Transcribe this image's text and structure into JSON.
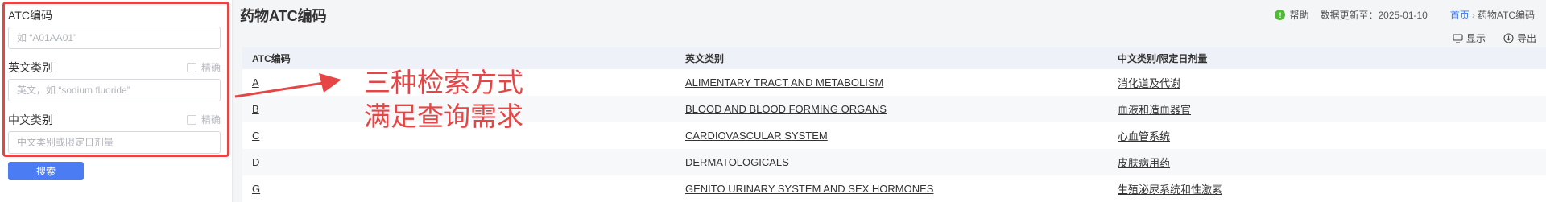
{
  "search_panel": {
    "atc_code": {
      "label": "ATC编码",
      "placeholder": "如 “A01AA01”"
    },
    "english_category": {
      "label": "英文类别",
      "exact_label": "精确",
      "placeholder": "英文，如 “sodium fluoride”"
    },
    "chinese_category": {
      "label": "中文类别",
      "exact_label": "精确",
      "placeholder": "中文类别或限定日剂量"
    },
    "search_button": "搜索"
  },
  "header": {
    "title": "药物ATC编码",
    "help": "帮助",
    "update_info": "数据更新至：2025-01-10",
    "breadcrumb": [
      "首页",
      "药物ATC编码"
    ]
  },
  "toolbar": {
    "display": "显示",
    "export": "导出"
  },
  "table": {
    "columns": [
      "ATC编码",
      "英文类别",
      "中文类别/限定日剂量"
    ],
    "rows": [
      [
        "A",
        "ALIMENTARY TRACT AND METABOLISM",
        "消化道及代谢"
      ],
      [
        "B",
        "BLOOD AND BLOOD FORMING ORGANS",
        "血液和造血器官"
      ],
      [
        "C",
        "CARDIOVASCULAR SYSTEM",
        "心血管系统"
      ],
      [
        "D",
        "DERMATOLOGICALS",
        "皮肤病用药"
      ],
      [
        "G",
        "GENITO URINARY SYSTEM AND SEX HORMONES",
        "生殖泌尿系统和性激素"
      ]
    ]
  },
  "annotation": {
    "line1": "三种检索方式",
    "line2": "满足查询需求",
    "color": "#e64545"
  }
}
